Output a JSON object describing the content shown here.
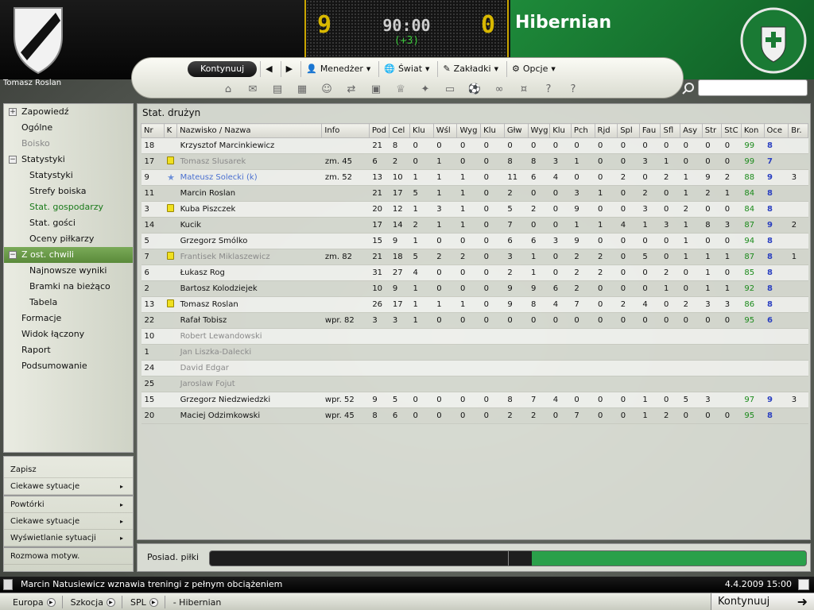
{
  "header": {
    "manager_name": "Tomasz Roslan",
    "home_score": "9",
    "away_score": "0",
    "clock": "90:00",
    "added_time": "(+3)",
    "club_name": "Hibernian",
    "club_color": "#1e8a3a",
    "crest_text_top": "HIBERNIAN",
    "crest_text_bottom": "EDINBURGH"
  },
  "nav": {
    "continue_label": "Kontynuuj",
    "menu": [
      {
        "label": "Menedżer"
      },
      {
        "label": "Świat"
      },
      {
        "label": "Zakładki"
      },
      {
        "label": "Opcje"
      }
    ],
    "icons": [
      "home-icon",
      "inbox-icon",
      "news-icon",
      "calendar-icon",
      "squad-icon",
      "transfer-icon",
      "tactics-icon",
      "trophy-icon",
      "scout-icon",
      "clipboard-icon",
      "match-icon",
      "binoculars-icon",
      "finance-icon",
      "help-icon",
      "question-icon"
    ],
    "search_placeholder": ""
  },
  "sidebar": {
    "items": [
      {
        "label": "Zapowiedź",
        "level": 0,
        "toggle": "+",
        "state": ""
      },
      {
        "label": "Ogólne",
        "level": 0,
        "toggle": "",
        "state": ""
      },
      {
        "label": "Boisko",
        "level": 0,
        "toggle": "",
        "state": "disabled"
      },
      {
        "label": "Statystyki",
        "level": 0,
        "toggle": "−",
        "state": ""
      },
      {
        "label": "Statystyki",
        "level": 1,
        "toggle": "",
        "state": ""
      },
      {
        "label": "Strefy boiska",
        "level": 1,
        "toggle": "",
        "state": ""
      },
      {
        "label": "Stat. gospodarzy",
        "level": 1,
        "toggle": "",
        "state": "active"
      },
      {
        "label": "Stat. gości",
        "level": 1,
        "toggle": "",
        "state": ""
      },
      {
        "label": "Oceny piłkarzy",
        "level": 1,
        "toggle": "",
        "state": ""
      },
      {
        "label": "Z ost. chwili",
        "level": 0,
        "toggle": "−",
        "state": "selected"
      },
      {
        "label": "Najnowsze wyniki",
        "level": 1,
        "toggle": "",
        "state": ""
      },
      {
        "label": "Bramki na bieżąco",
        "level": 1,
        "toggle": "",
        "state": ""
      },
      {
        "label": "Tabela",
        "level": 1,
        "toggle": "",
        "state": ""
      },
      {
        "label": "Formacje",
        "level": 0,
        "toggle": "",
        "state": ""
      },
      {
        "label": "Widok łączony",
        "level": 0,
        "toggle": "",
        "state": ""
      },
      {
        "label": "Raport",
        "level": 0,
        "toggle": "",
        "state": ""
      },
      {
        "label": "Podsumowanie",
        "level": 0,
        "toggle": "",
        "state": ""
      }
    ]
  },
  "side_panel": {
    "items": [
      {
        "label": "Zapisz",
        "arrow": ""
      },
      {
        "label": "Ciekawe sytuacje",
        "arrow": "▸"
      },
      {
        "label": "Powtórki",
        "arrow": "▸"
      },
      {
        "label": "Ciekawe sytuacje",
        "arrow": "▸"
      },
      {
        "label": "Wyświetlanie sytuacji",
        "arrow": "▸"
      },
      {
        "label": "Rozmowa motyw.",
        "arrow": ""
      }
    ]
  },
  "panel": {
    "title": "Stat. drużyn",
    "columns": [
      "Nr",
      "K",
      "Nazwisko / Nazwa",
      "Info",
      "Pod",
      "Cel",
      "Klu",
      "Wśl",
      "Wyg",
      "Klu",
      "Głw",
      "Wyg",
      "Klu",
      "Pch",
      "Rjd",
      "Spl",
      "Fau",
      "Sfl",
      "Asy",
      "Str",
      "StC",
      "Kon",
      "Oce",
      "Br."
    ],
    "rows": [
      {
        "nr": "18",
        "mark": "",
        "name": "Krzysztof Marcinkiewicz",
        "style": "",
        "info": "",
        "stats": [
          "21",
          "8",
          "0",
          "0",
          "0",
          "0",
          "0",
          "0",
          "0",
          "0",
          "0",
          "0",
          "0",
          "0",
          "0",
          "0",
          "0"
        ],
        "kon": "99",
        "oce": "8",
        "br": ""
      },
      {
        "nr": "17",
        "mark": "card",
        "name": "Tomasz Slusarek",
        "style": "dim",
        "info": "zm. 45",
        "stats": [
          "6",
          "2",
          "0",
          "1",
          "0",
          "0",
          "8",
          "8",
          "3",
          "1",
          "0",
          "0",
          "3",
          "1",
          "0",
          "0",
          "0"
        ],
        "kon": "99",
        "oce": "7",
        "br": ""
      },
      {
        "nr": "9",
        "mark": "star",
        "name": "Mateusz Solecki (k)",
        "style": "blue",
        "info": "zm. 52",
        "stats": [
          "13",
          "10",
          "1",
          "1",
          "1",
          "0",
          "11",
          "6",
          "4",
          "0",
          "0",
          "2",
          "0",
          "2",
          "1",
          "9",
          "2"
        ],
        "kon": "88",
        "oce": "9",
        "br": "3"
      },
      {
        "nr": "11",
        "mark": "",
        "name": "Marcin Roslan",
        "style": "",
        "info": "",
        "stats": [
          "21",
          "17",
          "5",
          "1",
          "1",
          "0",
          "2",
          "0",
          "0",
          "3",
          "1",
          "0",
          "2",
          "0",
          "1",
          "2",
          "1"
        ],
        "kon": "84",
        "oce": "8",
        "br": ""
      },
      {
        "nr": "3",
        "mark": "card",
        "name": "Kuba Piszczek",
        "style": "",
        "info": "",
        "stats": [
          "20",
          "12",
          "1",
          "3",
          "1",
          "0",
          "5",
          "2",
          "0",
          "9",
          "0",
          "0",
          "3",
          "0",
          "2",
          "0",
          "0"
        ],
        "kon": "84",
        "oce": "8",
        "br": ""
      },
      {
        "nr": "14",
        "mark": "",
        "name": "Kucik",
        "style": "",
        "info": "",
        "stats": [
          "17",
          "14",
          "2",
          "1",
          "1",
          "0",
          "7",
          "0",
          "0",
          "1",
          "1",
          "4",
          "1",
          "3",
          "1",
          "8",
          "3"
        ],
        "kon": "87",
        "oce": "9",
        "br": "2"
      },
      {
        "nr": "5",
        "mark": "",
        "name": "Grzegorz Smólko",
        "style": "",
        "info": "",
        "stats": [
          "15",
          "9",
          "1",
          "0",
          "0",
          "0",
          "6",
          "6",
          "3",
          "9",
          "0",
          "0",
          "0",
          "0",
          "1",
          "0",
          "0"
        ],
        "kon": "94",
        "oce": "8",
        "br": ""
      },
      {
        "nr": "7",
        "mark": "card",
        "name": "Frantisek Miklaszewicz",
        "style": "dim",
        "info": "zm. 82",
        "stats": [
          "21",
          "18",
          "5",
          "2",
          "2",
          "0",
          "3",
          "1",
          "0",
          "2",
          "2",
          "0",
          "5",
          "0",
          "1",
          "1",
          "1"
        ],
        "kon": "87",
        "oce": "8",
        "br": "1"
      },
      {
        "nr": "6",
        "mark": "",
        "name": "Łukasz Rog",
        "style": "",
        "info": "",
        "stats": [
          "31",
          "27",
          "4",
          "0",
          "0",
          "0",
          "2",
          "1",
          "0",
          "2",
          "2",
          "0",
          "0",
          "2",
          "0",
          "1",
          "0"
        ],
        "kon": "85",
        "oce": "8",
        "br": ""
      },
      {
        "nr": "2",
        "mark": "",
        "name": "Bartosz Kolodziejek",
        "style": "",
        "info": "",
        "stats": [
          "10",
          "9",
          "1",
          "0",
          "0",
          "0",
          "9",
          "9",
          "6",
          "2",
          "0",
          "0",
          "0",
          "1",
          "0",
          "1",
          "1"
        ],
        "kon": "92",
        "oce": "8",
        "br": ""
      },
      {
        "nr": "13",
        "mark": "card",
        "name": "Tomasz  Roslan",
        "style": "",
        "info": "",
        "stats": [
          "26",
          "17",
          "1",
          "1",
          "1",
          "0",
          "9",
          "8",
          "4",
          "7",
          "0",
          "2",
          "4",
          "0",
          "2",
          "3",
          "3"
        ],
        "kon": "86",
        "oce": "8",
        "br": ""
      },
      {
        "nr": "22",
        "mark": "",
        "name": "Rafał Tobisz",
        "style": "",
        "info": "wpr. 82",
        "stats": [
          "3",
          "3",
          "1",
          "0",
          "0",
          "0",
          "0",
          "0",
          "0",
          "0",
          "0",
          "0",
          "0",
          "0",
          "0",
          "0",
          "0"
        ],
        "kon": "95",
        "oce": "6",
        "br": ""
      },
      {
        "nr": "10",
        "mark": "",
        "name": "Robert Lewandowski",
        "style": "dim",
        "info": "",
        "stats": [],
        "kon": "",
        "oce": "",
        "br": ""
      },
      {
        "nr": "1",
        "mark": "",
        "name": "Jan Liszka-Dalecki",
        "style": "dim",
        "info": "",
        "stats": [],
        "kon": "",
        "oce": "",
        "br": ""
      },
      {
        "nr": "24",
        "mark": "",
        "name": "David Edgar",
        "style": "dim",
        "info": "",
        "stats": [],
        "kon": "",
        "oce": "",
        "br": ""
      },
      {
        "nr": "25",
        "mark": "",
        "name": "Jaroslaw Fojut",
        "style": "dim",
        "info": "",
        "stats": [],
        "kon": "",
        "oce": "",
        "br": ""
      },
      {
        "nr": "15",
        "mark": "",
        "name": "Grzegorz Niedzwiedzki",
        "style": "",
        "info": "wpr. 52",
        "stats": [
          "9",
          "5",
          "0",
          "0",
          "0",
          "0",
          "8",
          "7",
          "4",
          "0",
          "0",
          "0",
          "1",
          "0",
          "5",
          "3"
        ],
        "kon": "97",
        "oce": "9",
        "br": "3"
      },
      {
        "nr": "20",
        "mark": "",
        "name": "Maciej Odzimkowski",
        "style": "",
        "info": "wpr. 45",
        "stats": [
          "8",
          "6",
          "0",
          "0",
          "0",
          "0",
          "2",
          "2",
          "0",
          "7",
          "0",
          "0",
          "1",
          "2",
          "0",
          "0",
          "0"
        ],
        "kon": "95",
        "oce": "8",
        "br": ""
      }
    ]
  },
  "possession": {
    "label": "Posiad. piłki",
    "home_fraction": 0.54,
    "home_color": "#1e1e1e",
    "away_color": "#2aa04a"
  },
  "news": {
    "text": "Marcin Natusiewicz wznawia treningi z pełnym obciążeniem",
    "date": "4.4.2009 15:00"
  },
  "breadcrumbs": [
    {
      "label": "Europa"
    },
    {
      "label": "Szkocja"
    },
    {
      "label": "SPL"
    },
    {
      "label": "- Hibernian"
    }
  ],
  "continue_bottom": "Kontynuuj"
}
